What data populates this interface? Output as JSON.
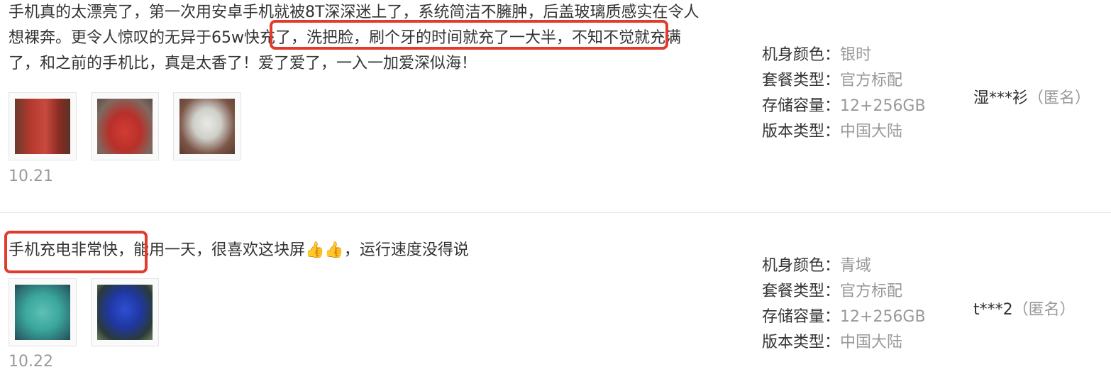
{
  "reviews": [
    {
      "text": "手机真的太漂亮了，第一次用安卓手机就被8T深深迷上了，系统简洁不臃肿，后盖玻璃质感实在令人想裸奔。更令人惊叹的无异于65w快充了，洗把脸，刷个牙的时间就充了一大半，不知不觉就充满了，和之前的手机比，真是太香了！爱了爱了，一入一加爱深似海！",
      "images": [
        "red-box-photo",
        "red-case-photo",
        "white-box-photo"
      ],
      "date": "10.21",
      "specs": [
        {
          "key": "机身颜色：",
          "value": "银时"
        },
        {
          "key": "套餐类型：",
          "value": "官方标配"
        },
        {
          "key": "存储容量：",
          "value": "12+256GB"
        },
        {
          "key": "版本类型：",
          "value": "中国大陆"
        }
      ],
      "user": {
        "name": "湿***衫",
        "anon": "（匿名）"
      }
    },
    {
      "text_before": "手机充电非常快，能用一天，很喜欢这块屏",
      "emoji": "👍👍",
      "text_after": "，运行速度没得说",
      "images": [
        "green-phone-photo",
        "blue-screen-photo"
      ],
      "date": "10.22",
      "specs": [
        {
          "key": "机身颜色：",
          "value": "青域"
        },
        {
          "key": "套餐类型：",
          "value": "官方标配"
        },
        {
          "key": "存储容量：",
          "value": "12+256GB"
        },
        {
          "key": "版本类型：",
          "value": "中国大陆"
        }
      ],
      "user": {
        "name": "t***2",
        "anon": "（匿名）"
      }
    }
  ],
  "colors": {
    "highlight": "#e23b2e",
    "muted": "#999999",
    "text": "#333333"
  }
}
